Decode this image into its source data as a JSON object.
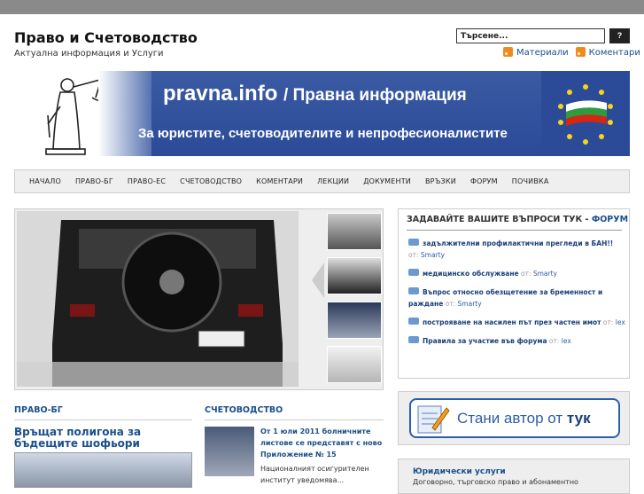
{
  "header": {
    "title": "Право и Счетоводство",
    "tagline": "Актуална информация и Услуги",
    "search_placeholder": "Търсене...",
    "search_button": "?",
    "feeds": {
      "materials": "Материали",
      "comments": "Коментари"
    }
  },
  "banner": {
    "site": "pravna.info",
    "site_suffix": "/ Правна информация",
    "tagline": "За юристите, счетоводителите и непрофесионалистите"
  },
  "nav": {
    "items": [
      "НАЧАЛО",
      "ПРАВО-БГ",
      "ПРАВО-ЕС",
      "СЧЕТОВОДСТВО",
      "КОМЕНТАРИ",
      "ЛЕКЦИИ",
      "ДОКУМЕНТИ",
      "ВРЪЗКИ",
      "ФОРУМ",
      "ПОЧИВКА"
    ]
  },
  "forum": {
    "title": "ЗАДАВАЙТЕ ВАШИТЕ ВЪПРОСИ ТУК - ",
    "title_link": "ФОРУМ",
    "by_label": "от:",
    "posts": [
      {
        "title": "задължителни профилактични прегледи в БАН!!",
        "author": "Smarty"
      },
      {
        "title": "медицинско обслужване",
        "author": "Smarty"
      },
      {
        "title": "Въпрос относно обезщетение за бременност и раждане",
        "author": "Smarty"
      },
      {
        "title": "построяване на насилен път през частен имот",
        "author": "lex"
      },
      {
        "title": "Правила за участие във форума",
        "author": "lex"
      }
    ]
  },
  "author_box": {
    "label": "Стани автор от",
    "link": "тук"
  },
  "services": {
    "title": "Юридически услуги",
    "desc": "Договорно, търговско право и абонаментно"
  },
  "pravo_bg": {
    "heading": "ПРАВО-БГ",
    "article_title": "Връщат полигона за бъдещите шофьори"
  },
  "accounting": {
    "heading": "СЧЕТОВОДСТВО",
    "article_link": "От 1 юли 2011 болничните листове се представят с ново Приложение № 15",
    "excerpt": "Националният осигурителен институт уведомява..."
  },
  "colors": {
    "link": "#1a4f8b",
    "banner_blue": "#2b4b98",
    "topbar": "#8a8a8a"
  }
}
